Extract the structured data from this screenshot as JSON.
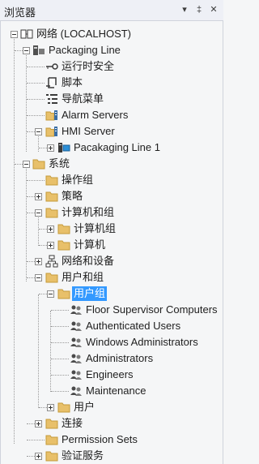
{
  "panel": {
    "title": "浏览器",
    "dropdown_glyph": "▾",
    "pin_glyph": "‡",
    "close_glyph": "✕"
  },
  "tree": {
    "root": "网络 (LOCALHOST)",
    "packaging_line": "Packaging Line",
    "runtime_security": "运行时安全",
    "script": "脚本",
    "nav_menu": "导航菜单",
    "alarm_servers": "Alarm Servers",
    "hmi_server": "HMI Server",
    "hmi_child": "Pacakaging Line 1",
    "system": "系统",
    "action_group": "操作组",
    "policy": "策略",
    "computers_and_groups": "计算机和组",
    "computer_groups": "计算机组",
    "computers": "计算机",
    "network_devices": "网络和设备",
    "users_and_groups": "用户和组",
    "user_groups": "用户组",
    "user_group_items": [
      "Floor Supervisor Computers",
      "Authenticated Users",
      "Windows Administrators",
      "Administrators",
      "Engineers",
      "Maintenance"
    ],
    "users": "用户",
    "connections": "连接",
    "permission_sets": "Permission Sets",
    "auth_services": "验证服务"
  },
  "colors": {
    "folder": "#e8c06a",
    "selection": "#3399ff"
  }
}
